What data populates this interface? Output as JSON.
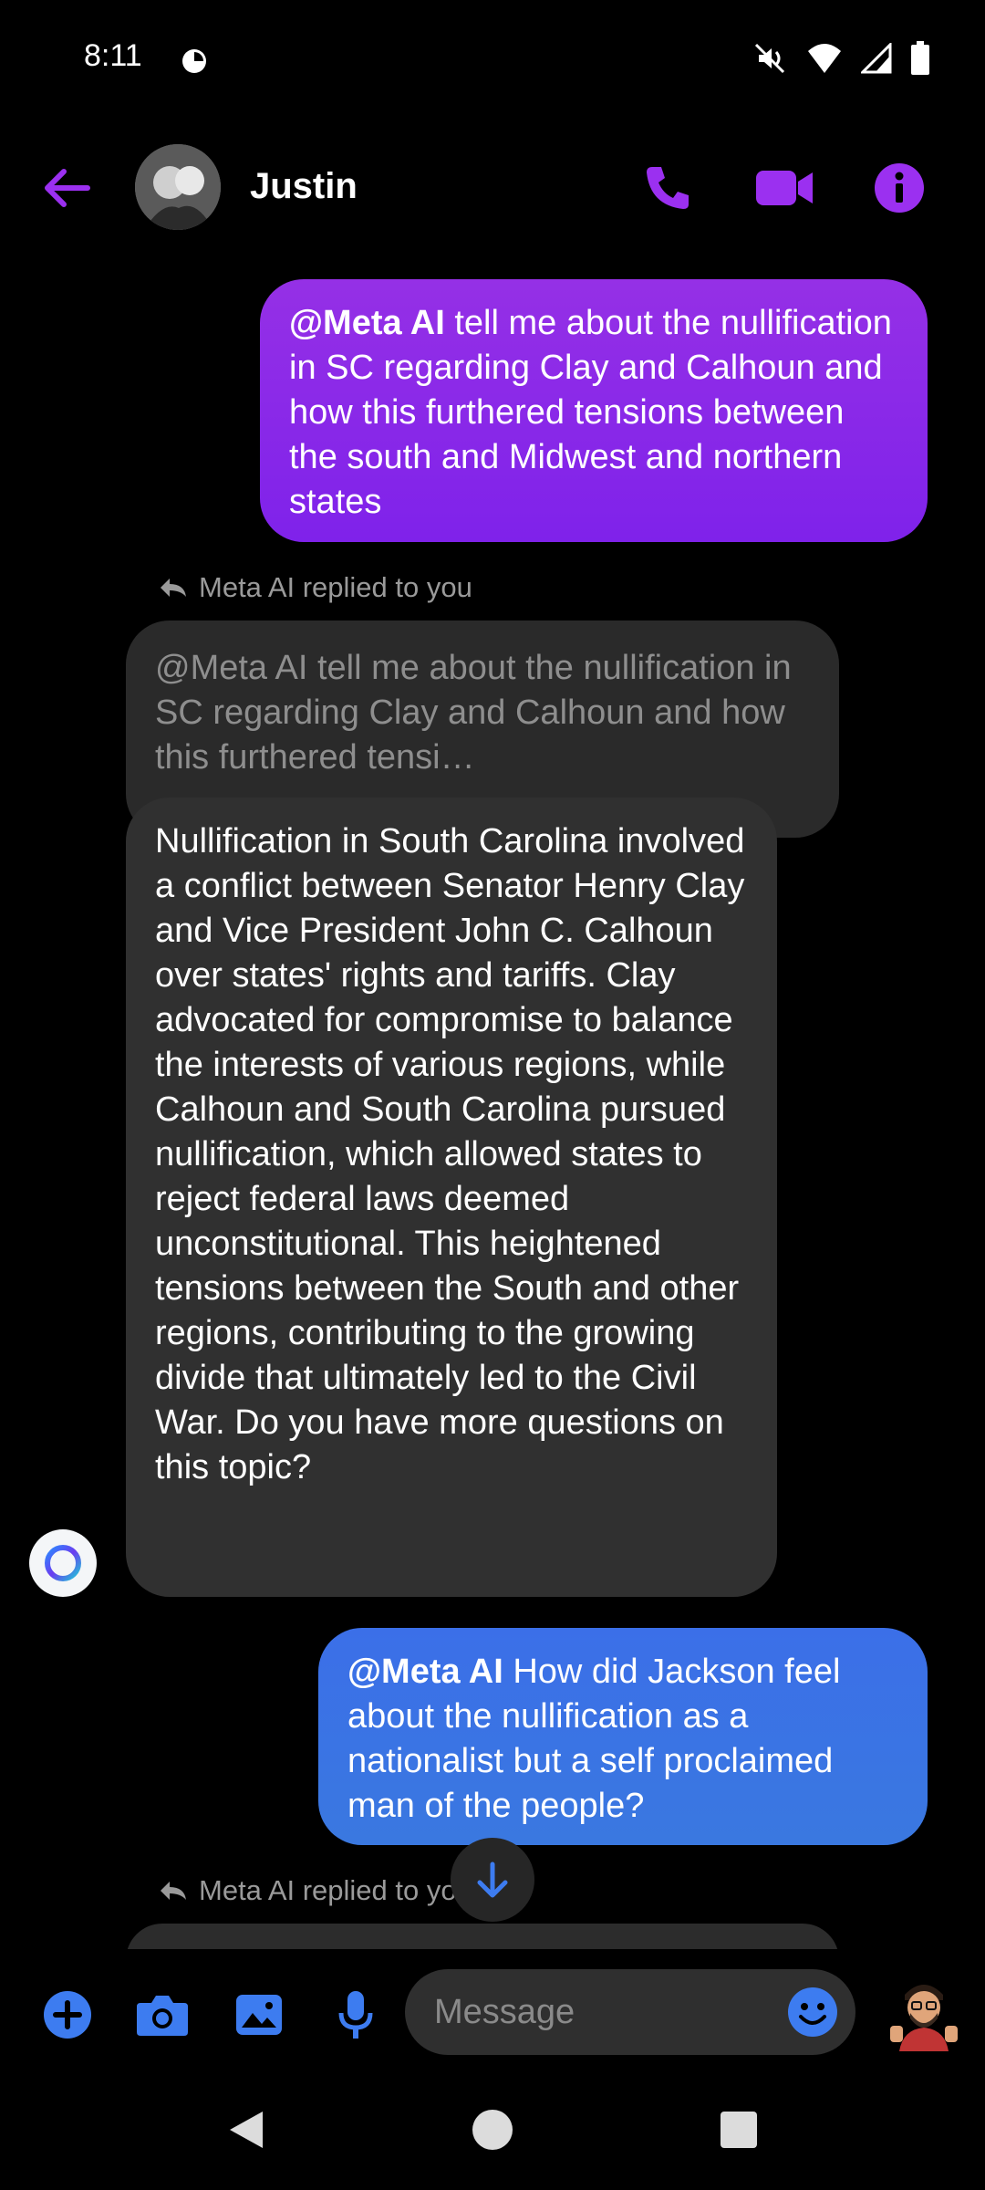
{
  "status_bar": {
    "time": "8:11"
  },
  "header": {
    "contact_name": "Justin"
  },
  "messages": [
    {
      "sender": "user",
      "mention": "@Meta AI",
      "text": " tell me about the nullification in SC regarding Clay and Calhoun and how this furthered tensions between the south and Midwest and northern states"
    },
    {
      "sender": "ai",
      "reply_label": "Meta AI replied to you",
      "quoted": "@Meta AI tell me about the nullification in SC regarding Clay and Calhoun and how this furthered tensi…",
      "text": "Nullification in South Carolina involved a conflict between Senator Henry Clay and Vice President John C. Calhoun over states' rights and tariffs. Clay advocated for compromise to balance the interests of various regions, while Calhoun and South Carolina pursued nullification, which allowed states to reject federal laws deemed unconstitutional. This heightened tensions between the South and other regions, contributing to the growing divide that ultimately led to the Civil War. Do you have more questions on this topic?"
    },
    {
      "sender": "user",
      "mention": "@Meta AI",
      "text": "  How did Jackson feel about the nullification as a nationalist but a self proclaimed man of the people?"
    },
    {
      "sender": "ai",
      "reply_label": "Meta AI replied to yo"
    }
  ],
  "composer": {
    "placeholder": "Message"
  },
  "colors": {
    "accent_purple": "#9b30f0",
    "accent_blue": "#3d7cf0",
    "background": "#000000"
  },
  "icons": [
    "back-arrow-icon",
    "phone-icon",
    "video-icon",
    "info-icon",
    "plus-icon",
    "camera-icon",
    "gallery-icon",
    "mic-icon",
    "emoji-icon",
    "arrow-down-icon"
  ]
}
